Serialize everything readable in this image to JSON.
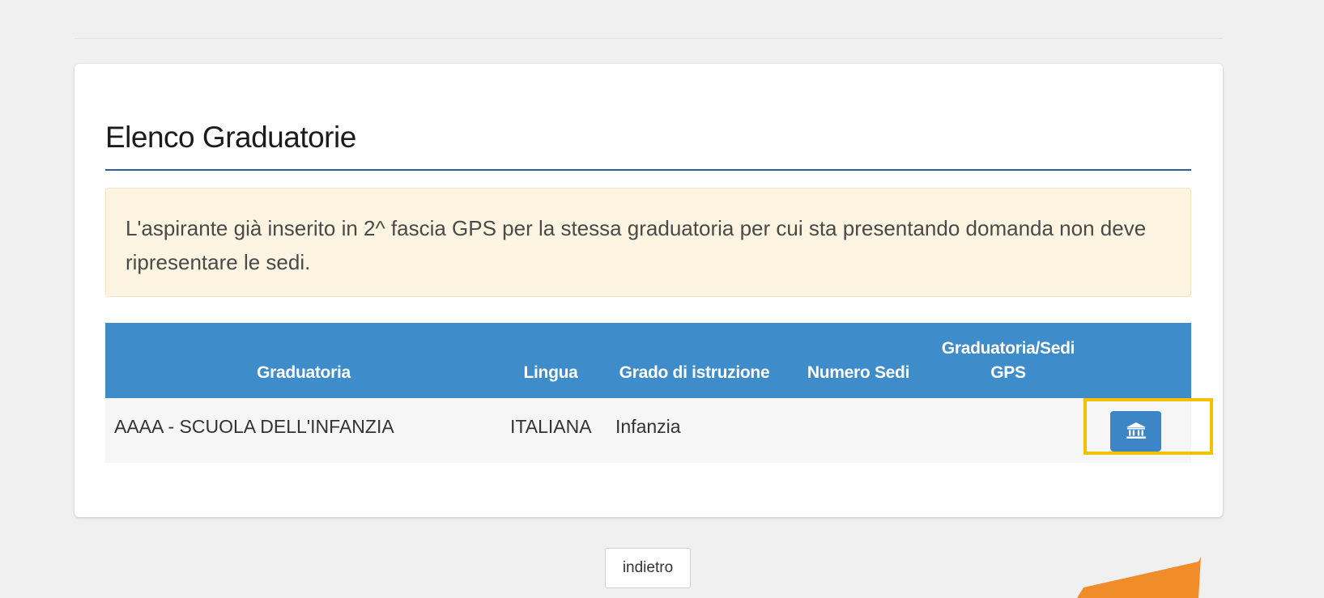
{
  "section": {
    "title": "Elenco Graduatorie"
  },
  "alert": {
    "text": "L'aspirante già inserito in 2^ fascia GPS per la stessa graduatoria per cui sta presentando domanda non deve ripresentare le sedi."
  },
  "table": {
    "headers": {
      "graduatoria": "Graduatoria",
      "lingua": "Lingua",
      "grado": "Grado di istruzione",
      "numero_sedi": "Numero Sedi",
      "gps_line1": "Graduatoria/Sedi",
      "gps_line2": "GPS"
    },
    "rows": [
      {
        "graduatoria": "AAAA - SCUOLA DELL'INFANZIA",
        "lingua": "ITALIANA",
        "grado": "Infanzia",
        "numero_sedi": "",
        "action_icon": "institution-icon"
      }
    ]
  },
  "footer": {
    "back_label": "indietro"
  },
  "colors": {
    "header_blue": "#3f8ccb",
    "title_rule": "#2e5f98",
    "alert_bg": "#fdf4e1",
    "highlight": "#f5c000",
    "arrow": "#f08c2a"
  }
}
